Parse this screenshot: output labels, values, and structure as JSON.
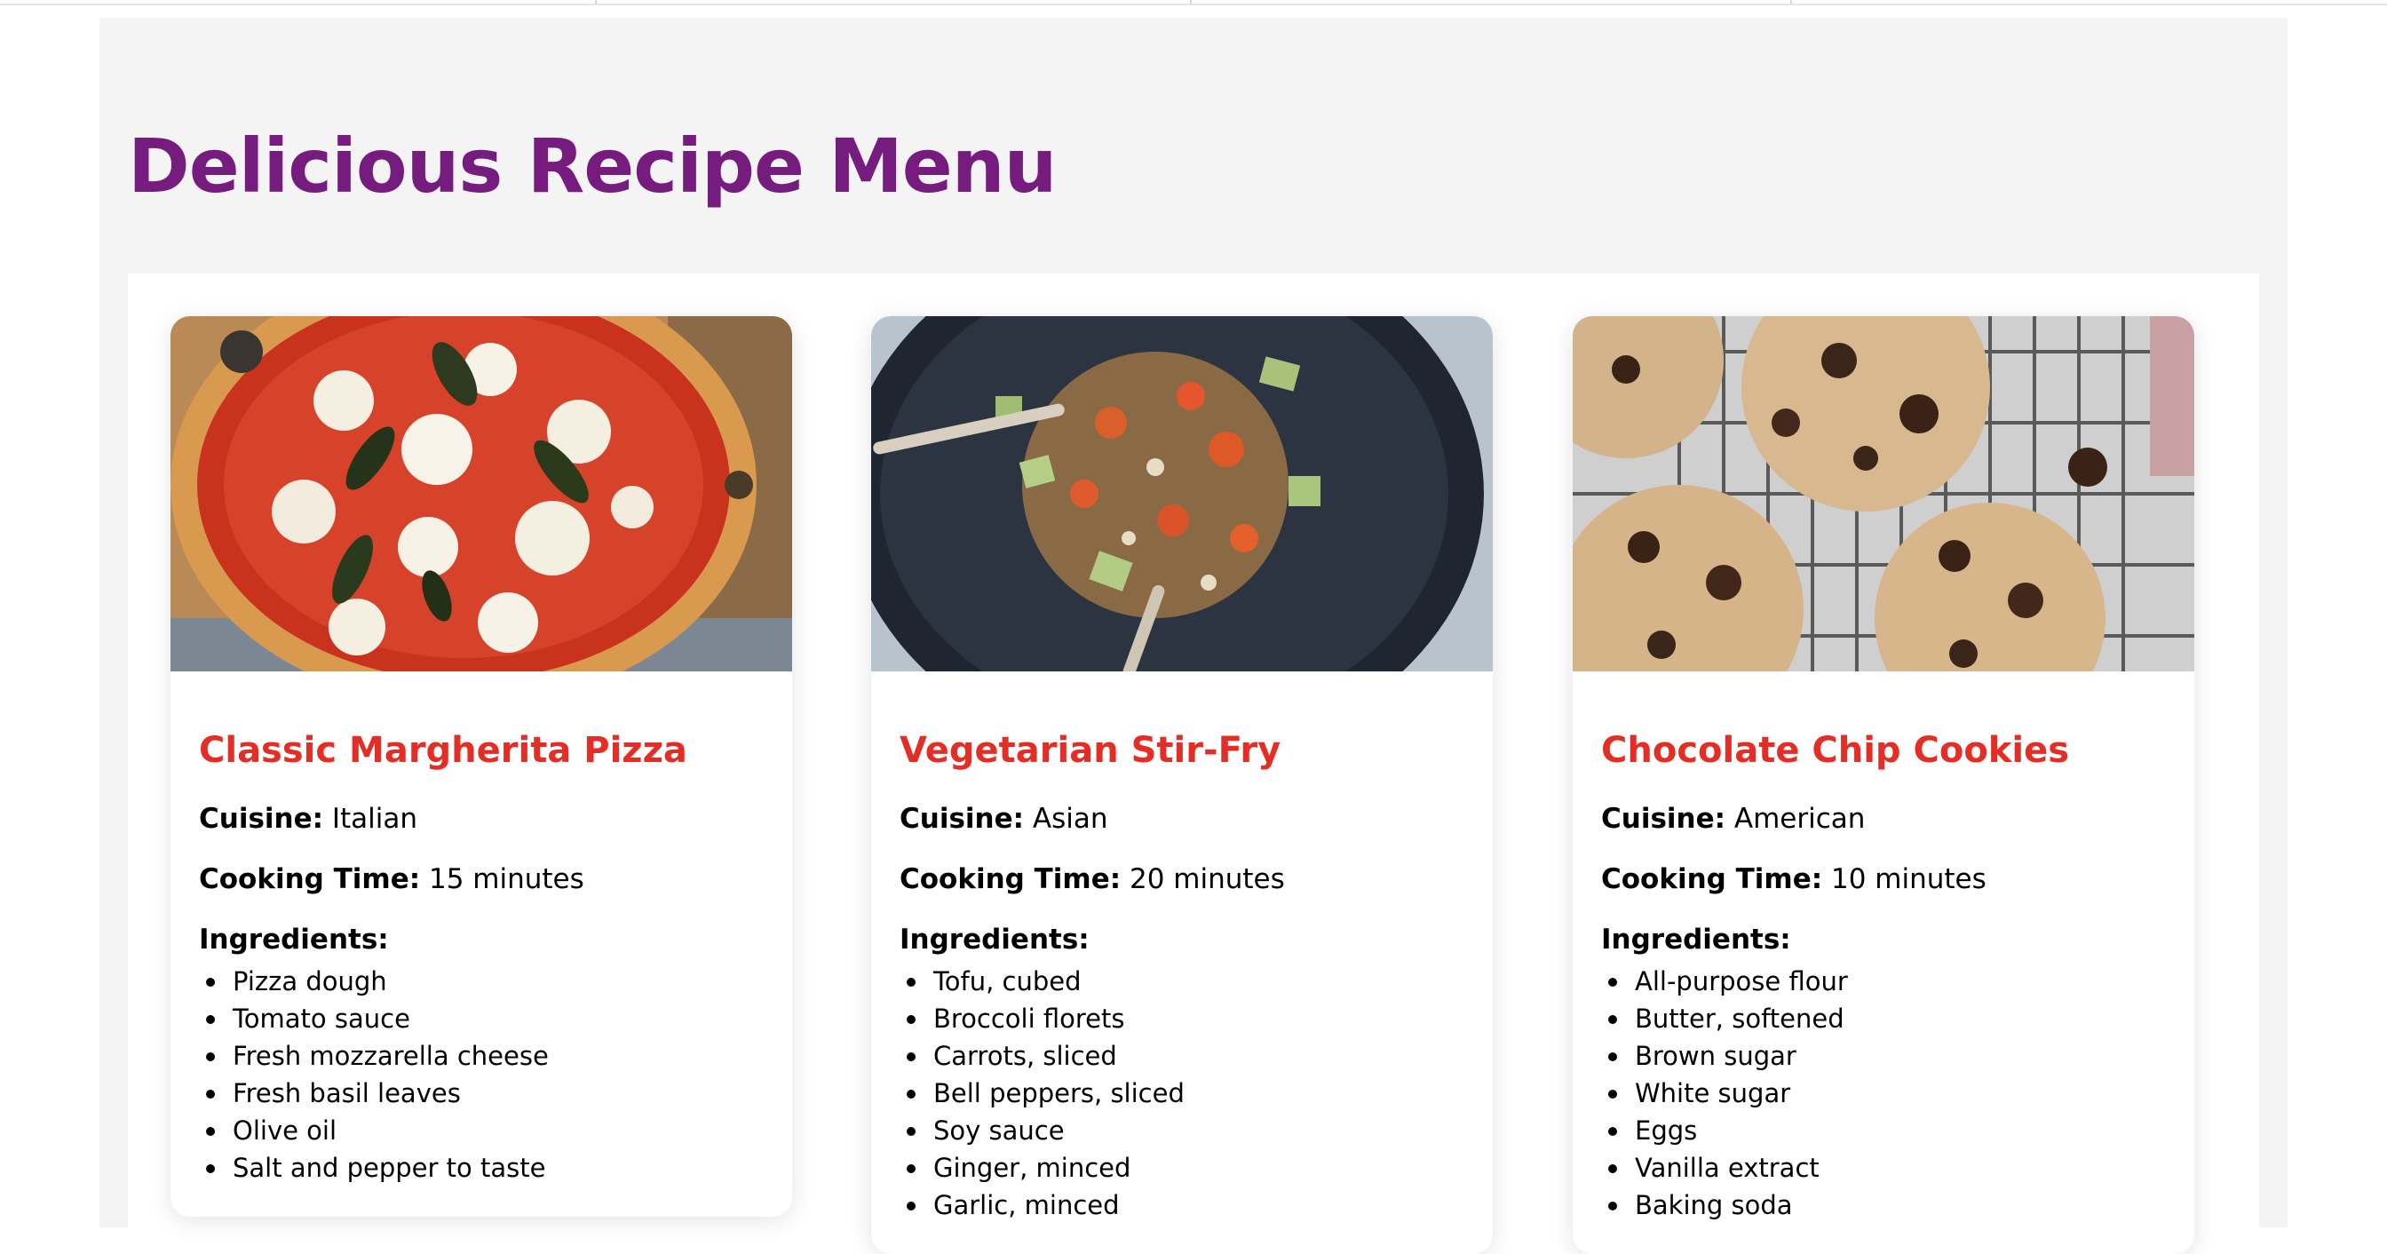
{
  "page": {
    "title": "Delicious Recipe Menu"
  },
  "colors": {
    "title": "#751c7e",
    "recipe_title": "#e42d24",
    "page_background": "#f4f4f4",
    "card_background": "#ffffff"
  },
  "labels": {
    "cuisine": "Cuisine:",
    "cooking_time": "Cooking Time:",
    "ingredients": "Ingredients:"
  },
  "recipes": [
    {
      "name": "Classic Margherita Pizza",
      "image": "margherita-pizza-photo",
      "cuisine": "Italian",
      "cooking_time": "15 minutes",
      "ingredients": [
        "Pizza dough",
        "Tomato sauce",
        "Fresh mozzarella cheese",
        "Fresh basil leaves",
        "Olive oil",
        "Salt and pepper to taste"
      ]
    },
    {
      "name": "Vegetarian Stir-Fry",
      "image": "stir-fry-photo",
      "cuisine": "Asian",
      "cooking_time": "20 minutes",
      "ingredients": [
        "Tofu, cubed",
        "Broccoli florets",
        "Carrots, sliced",
        "Bell peppers, sliced",
        "Soy sauce",
        "Ginger, minced",
        "Garlic, minced"
      ]
    },
    {
      "name": "Chocolate Chip Cookies",
      "image": "chocolate-chip-cookies-photo",
      "cuisine": "American",
      "cooking_time": "10 minutes",
      "ingredients": [
        "All-purpose flour",
        "Butter, softened",
        "Brown sugar",
        "White sugar",
        "Eggs",
        "Vanilla extract",
        "Baking soda"
      ]
    }
  ]
}
